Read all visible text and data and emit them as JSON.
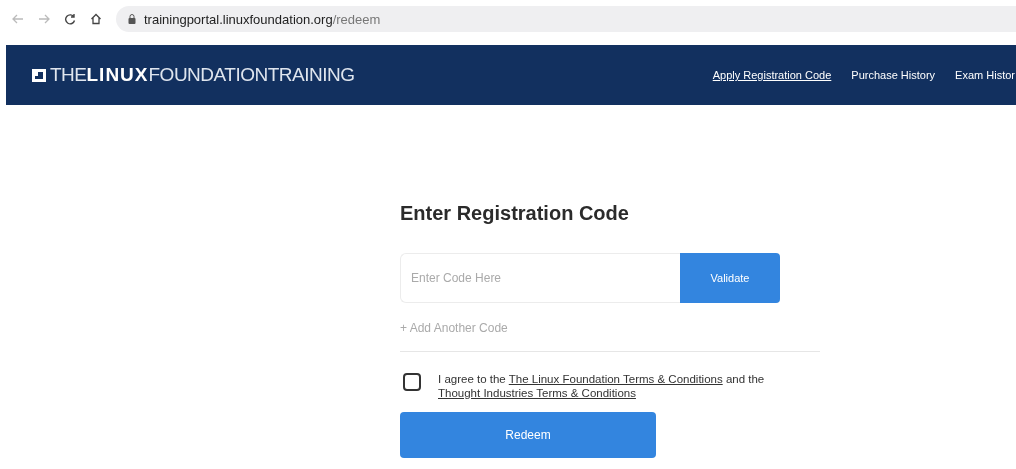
{
  "browser": {
    "url_host": "trainingportal.linuxfoundation.org",
    "url_path": "/redeem"
  },
  "header": {
    "logo": "THE**LINUX**FOUNDATIONTRAINING",
    "nav": [
      {
        "label": "Apply Registration Code",
        "selected": true
      },
      {
        "label": "Purchase History",
        "selected": false
      },
      {
        "label": "Exam Histor",
        "selected": false
      }
    ]
  },
  "form": {
    "title": "Enter Registration Code",
    "code_field": {
      "placeholder": "Enter Code Here"
    },
    "validate_button": "Validate",
    "add_code": "+ Add Another Code",
    "agreement": {
      "checked": false,
      "prefix": "I agree to the ",
      "link_1": "The Linux Foundation Terms & Conditions",
      "middle": " and the ",
      "link_2": "Thought Industries Terms & Conditions"
    },
    "submit_button": "Redeem"
  }
}
